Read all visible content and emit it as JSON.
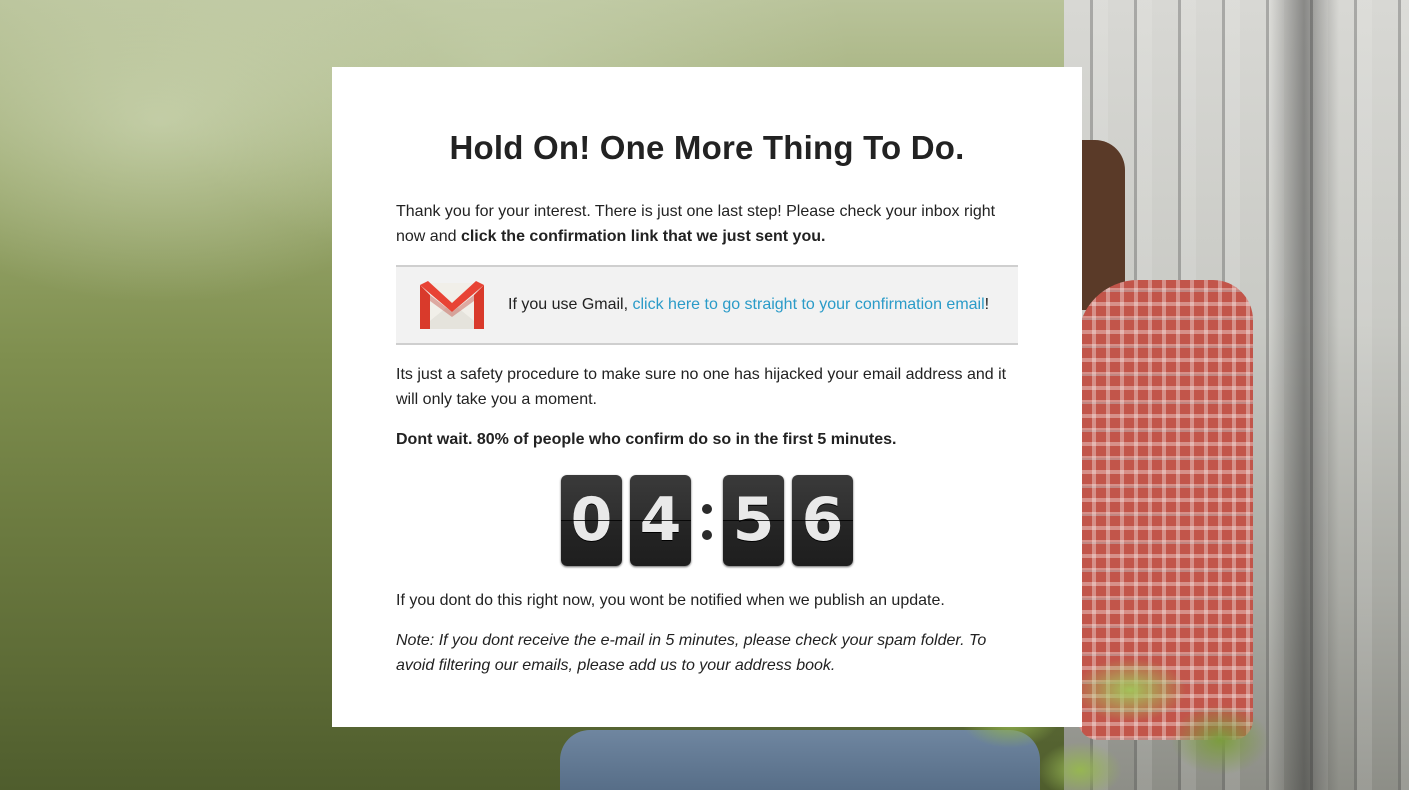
{
  "modal": {
    "title": "Hold On! One More Thing To Do.",
    "intro_text": "Thank you for your interest. There is just one last step! Please check your inbox right now and ",
    "intro_bold": "click the confirmation link that we just sent you.",
    "gmail": {
      "icon": "gmail-icon",
      "prefix": "If you use Gmail, ",
      "link_text": "click here to go straight to your confirmation email",
      "suffix": "!"
    },
    "safety_text": "Its just a safety procedure to make sure no one has hijacked your email address and it will only take you a moment.",
    "urgency_text": "Dont wait. 80% of people who confirm do so in the first 5 minutes.",
    "countdown": {
      "digits": [
        "0",
        "4",
        "5",
        "6"
      ],
      "separator": ":"
    },
    "warning_text": "If you dont do this right now, you wont be notified when we publish an update.",
    "note_text": "Note: If you dont receive the e-mail in 5 minutes, please check your spam folder. To avoid filtering our emails, please add us to your address book."
  },
  "colors": {
    "link": "#2a9bc8",
    "card_bg": "#ffffff",
    "gmail_box_bg": "#f2f2f2",
    "digit_bg": "#2e2e2e"
  }
}
